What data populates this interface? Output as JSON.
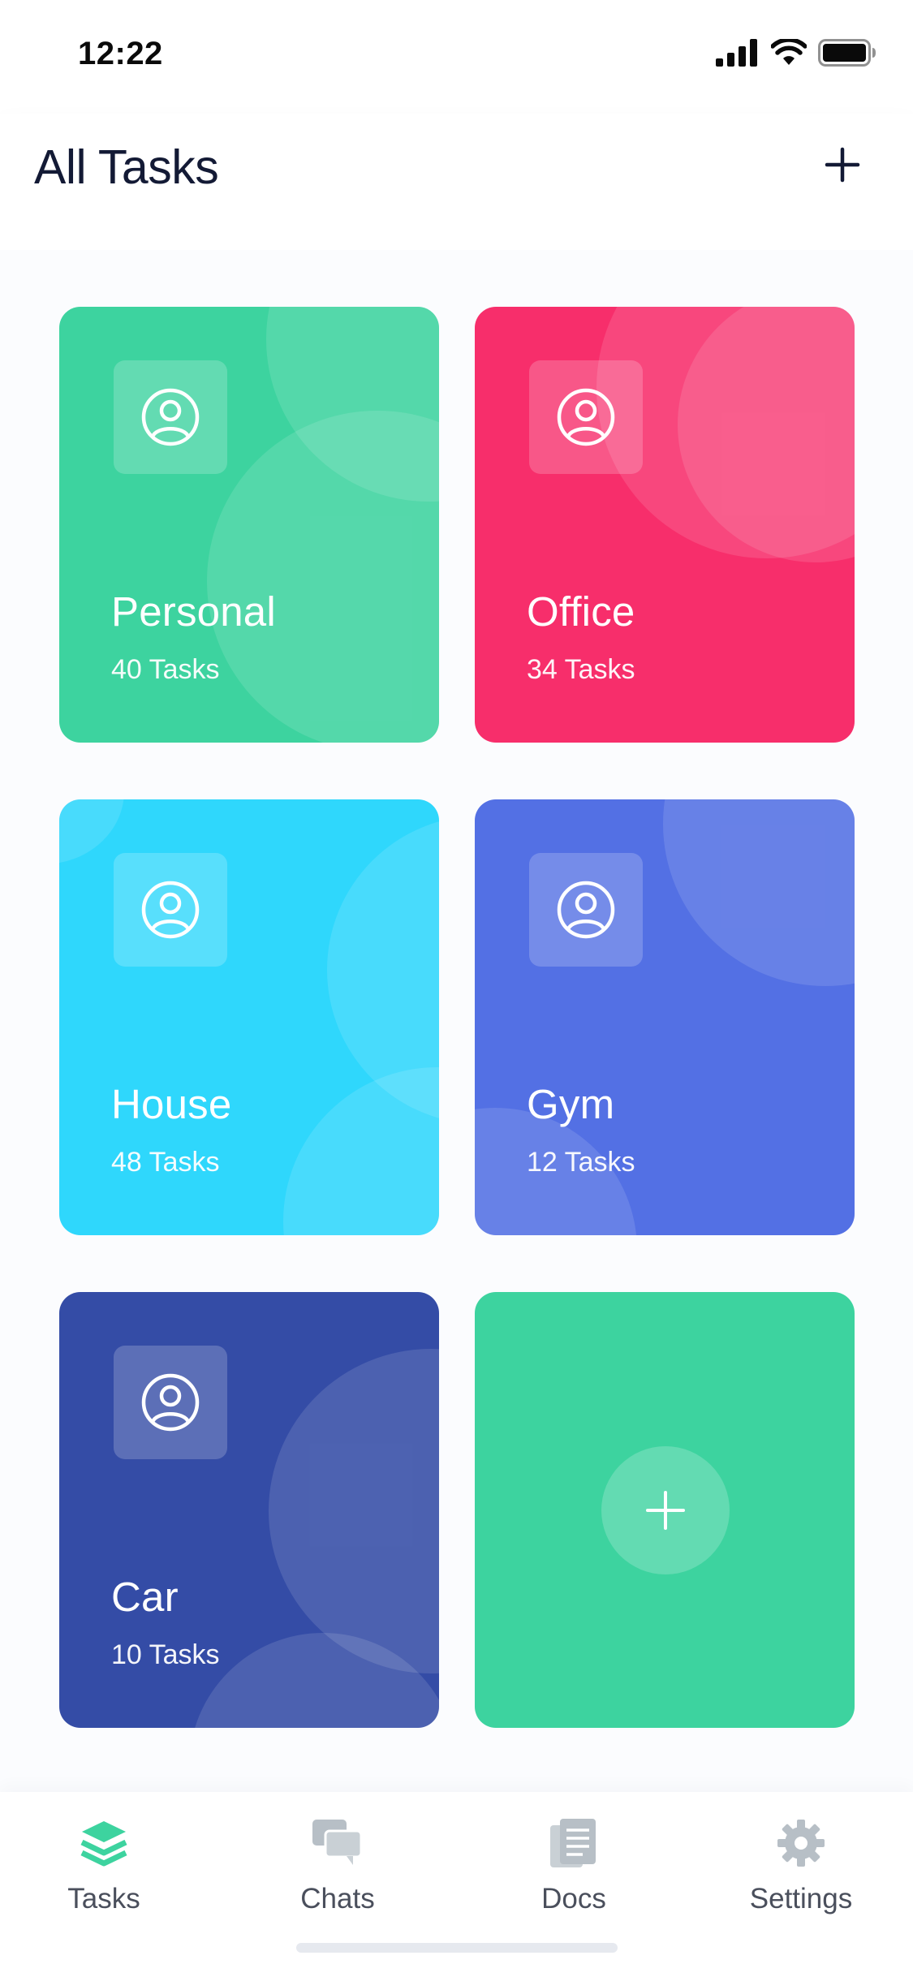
{
  "status_bar": {
    "time": "12:22",
    "icons": [
      "cellular-signal-icon",
      "wifi-icon",
      "battery-icon"
    ]
  },
  "header": {
    "title": "All Tasks",
    "add_icon": "plus-icon"
  },
  "colors": {
    "personal": "#3dd39f",
    "office": "#f72e6b",
    "house": "#2fd7fc",
    "gym": "#5370e4",
    "car": "#344ca6",
    "add_card": "#3dd39f",
    "tab_active": "#3dd39f",
    "tab_inactive": "#b7bfc6"
  },
  "categories": [
    {
      "id": "personal",
      "title": "Personal",
      "count": "40 Tasks",
      "icon": "user-circle-icon"
    },
    {
      "id": "office",
      "title": "Office",
      "count": "34 Tasks",
      "icon": "user-circle-icon"
    },
    {
      "id": "house",
      "title": "House",
      "count": "48 Tasks",
      "icon": "user-circle-icon"
    },
    {
      "id": "gym",
      "title": "Gym",
      "count": "12 Tasks",
      "icon": "user-circle-icon"
    },
    {
      "id": "car",
      "title": "Car",
      "count": "10 Tasks",
      "icon": "user-circle-icon"
    }
  ],
  "add_card": {
    "icon": "plus-icon"
  },
  "tab_bar": {
    "active": "tasks",
    "tabs": [
      {
        "id": "tasks",
        "label": "Tasks",
        "icon": "layers-icon"
      },
      {
        "id": "chats",
        "label": "Chats",
        "icon": "chat-bubbles-icon"
      },
      {
        "id": "docs",
        "label": "Docs",
        "icon": "document-icon"
      },
      {
        "id": "settings",
        "label": "Settings",
        "icon": "gear-icon"
      }
    ]
  }
}
